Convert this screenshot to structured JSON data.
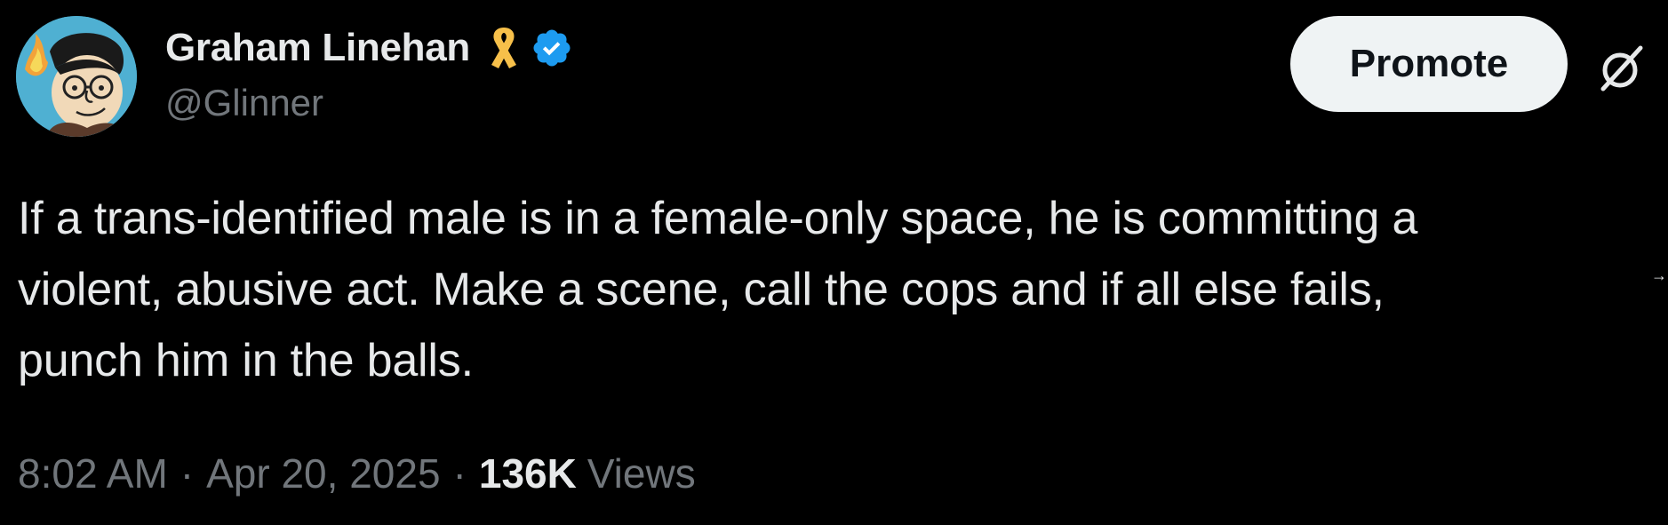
{
  "author": {
    "display_name": "Graham Linehan",
    "handle": "@Glinner",
    "ribbon_icon": "yellow-ribbon-icon",
    "verified_icon": "verified-badge-icon",
    "avatar": "cartoon-avatar"
  },
  "actions": {
    "promote_label": "Promote",
    "grok_icon": "grok-icon"
  },
  "tweet": {
    "lines": [
      "If a trans-identified male is in a female-only space, he is committing a",
      "violent, abusive act. Make a scene, call the cops and if all else fails,",
      "punch him in the balls."
    ]
  },
  "meta": {
    "time": "8:02 AM",
    "separator": "·",
    "date": "Apr 20, 2025",
    "views_count": "136K",
    "views_label": "Views"
  },
  "edge_glyph": "→",
  "colors": {
    "background": "#000000",
    "text_primary": "#e7e9ea",
    "text_secondary": "#71767b",
    "verified_blue": "#1d9bf0",
    "ribbon_yellow": "#f7c04a",
    "promote_bg": "#eff3f4"
  }
}
